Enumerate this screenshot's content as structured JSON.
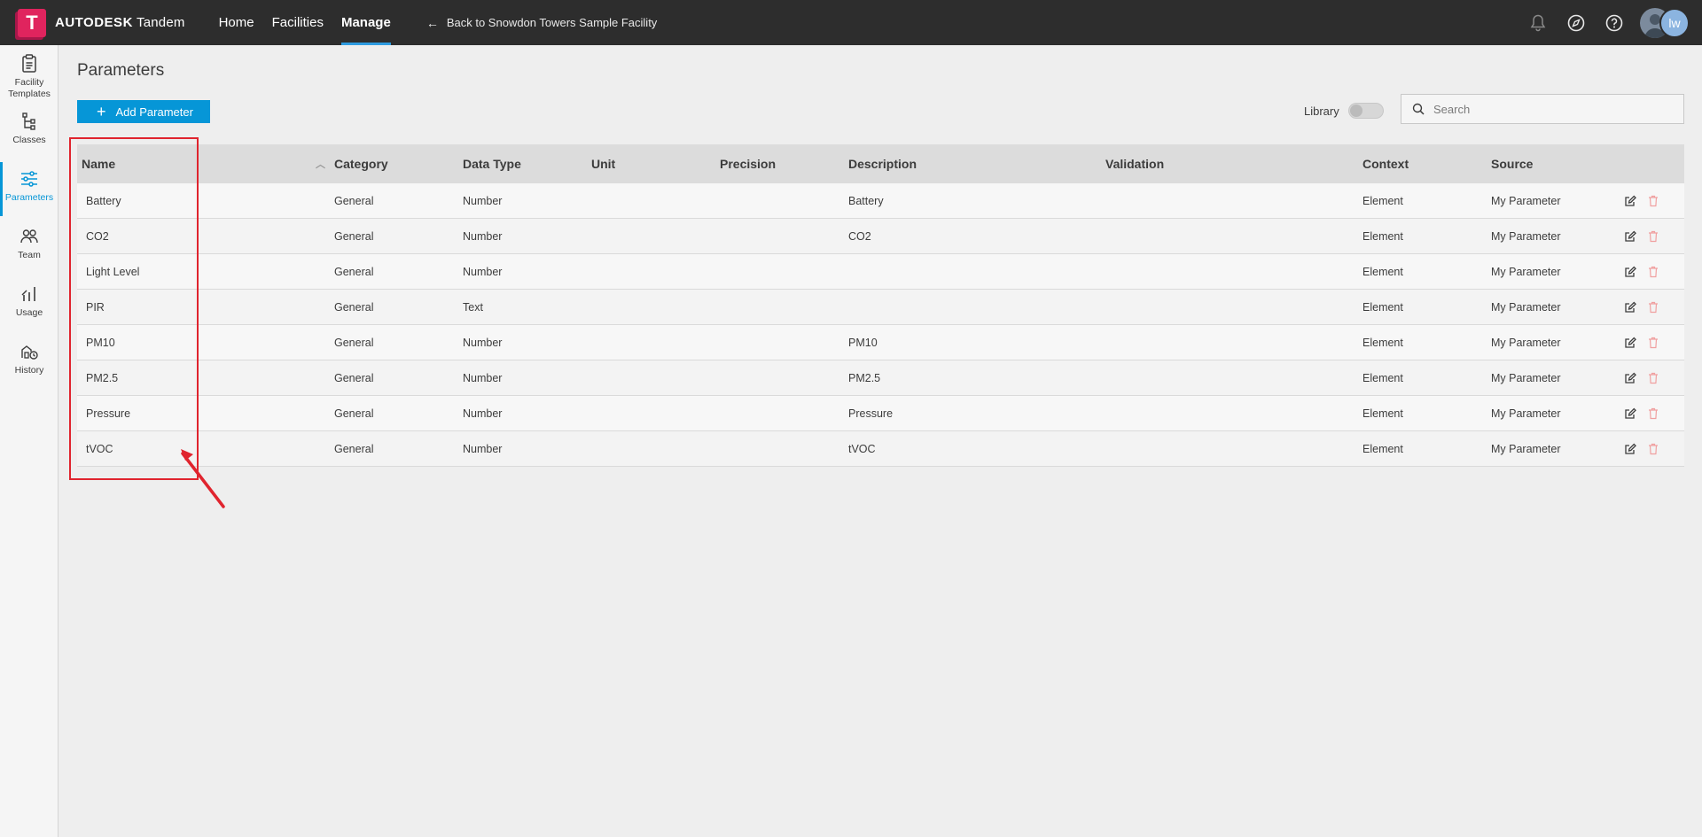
{
  "brand": {
    "logo_letter": "T",
    "company": "AUTODESK",
    "product": "Tandem"
  },
  "nav": [
    {
      "label": "Home",
      "active": false
    },
    {
      "label": "Facilities",
      "active": false
    },
    {
      "label": "Manage",
      "active": true
    }
  ],
  "back_link": "Back to Snowdon Towers Sample Facility",
  "top_icons": [
    "bell-icon",
    "compass-icon",
    "help-icon"
  ],
  "user": {
    "initials": "lw"
  },
  "sidebar": {
    "items": [
      {
        "label": "Facility Templates",
        "icon": "clipboard-icon",
        "active": false
      },
      {
        "label": "Classes",
        "icon": "hierarchy-icon",
        "active": false
      },
      {
        "label": "Parameters",
        "icon": "sliders-icon",
        "active": true
      },
      {
        "label": "Team",
        "icon": "people-icon",
        "active": false
      },
      {
        "label": "Usage",
        "icon": "bar-chart-icon",
        "active": false
      },
      {
        "label": "History",
        "icon": "history-icon",
        "active": false
      }
    ]
  },
  "page": {
    "title": "Parameters",
    "add_button": "Add Parameter",
    "library_label": "Library",
    "library_on": false,
    "search_placeholder": "Search"
  },
  "table": {
    "headers": {
      "name": "Name",
      "category": "Category",
      "data_type": "Data Type",
      "unit": "Unit",
      "precision": "Precision",
      "description": "Description",
      "validation": "Validation",
      "context": "Context",
      "source": "Source"
    },
    "rows": [
      {
        "name": "Battery",
        "category": "General",
        "data_type": "Number",
        "unit": "",
        "precision": "",
        "description": "Battery",
        "validation": "",
        "context": "Element",
        "source": "My Parameter"
      },
      {
        "name": "CO2",
        "category": "General",
        "data_type": "Number",
        "unit": "",
        "precision": "",
        "description": "CO2",
        "validation": "",
        "context": "Element",
        "source": "My Parameter"
      },
      {
        "name": "Light Level",
        "category": "General",
        "data_type": "Number",
        "unit": "",
        "precision": "",
        "description": "",
        "validation": "",
        "context": "Element",
        "source": "My Parameter"
      },
      {
        "name": "PIR",
        "category": "General",
        "data_type": "Text",
        "unit": "",
        "precision": "",
        "description": "",
        "validation": "",
        "context": "Element",
        "source": "My Parameter"
      },
      {
        "name": "PM10",
        "category": "General",
        "data_type": "Number",
        "unit": "",
        "precision": "",
        "description": "PM10",
        "validation": "",
        "context": "Element",
        "source": "My Parameter"
      },
      {
        "name": "PM2.5",
        "category": "General",
        "data_type": "Number",
        "unit": "",
        "precision": "",
        "description": "PM2.5",
        "validation": "",
        "context": "Element",
        "source": "My Parameter"
      },
      {
        "name": "Pressure",
        "category": "General",
        "data_type": "Number",
        "unit": "",
        "precision": "",
        "description": "Pressure",
        "validation": "",
        "context": "Element",
        "source": "My Parameter"
      },
      {
        "name": "tVOC",
        "category": "General",
        "data_type": "Number",
        "unit": "",
        "precision": "",
        "description": "tVOC",
        "validation": "",
        "context": "Element",
        "source": "My Parameter"
      }
    ]
  },
  "colors": {
    "accent": "#0696d7",
    "topbar": "#2d2d2d",
    "brand_logo": "#e0245e",
    "annotation": "#e0242e",
    "delete_icon": "#f0a0a0"
  }
}
